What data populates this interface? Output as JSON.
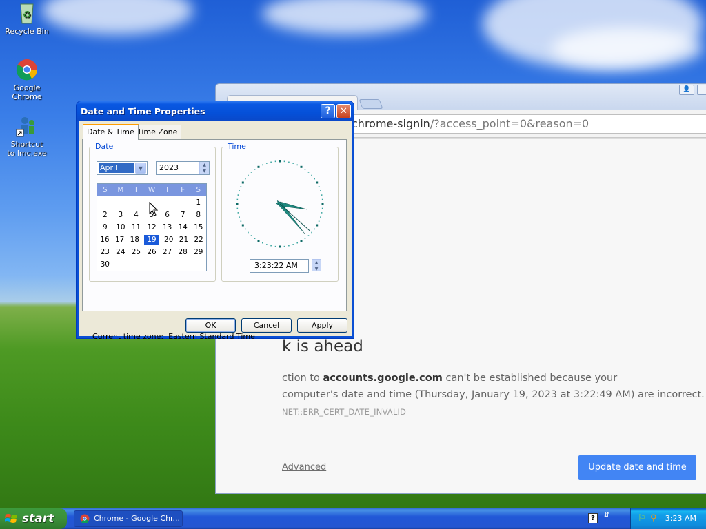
{
  "desktop": {
    "icons": [
      {
        "label": "Recycle Bin"
      },
      {
        "label": "Google Chrome"
      },
      {
        "label": "Shortcut to lmc.exe"
      }
    ]
  },
  "chrome": {
    "address_highlight": "chrome-signin",
    "address_rest": "/?access_point=0&reason=0",
    "error": {
      "heading": "k is ahead",
      "para_lead": "ction to ",
      "domain": "accounts.google.com",
      "para_tail": " can't be established because your",
      "para_line2": "computer's date and time (Thursday, January 19, 2023 at 3:22:49 AM) are incorrect.",
      "code": "NET::ERR_CERT_DATE_INVALID",
      "advanced": "Advanced",
      "update_button": "Update date and time"
    }
  },
  "dialog": {
    "title": "Date and Time Properties",
    "help": "?",
    "close": "✕",
    "tabs": [
      "Date & Time",
      "Time Zone"
    ],
    "date_group": "Date",
    "time_group": "Time",
    "month": "April",
    "year": "2023",
    "weekdays": [
      "S",
      "M",
      "T",
      "W",
      "T",
      "F",
      "S"
    ],
    "weeks": [
      [
        "",
        "",
        "",
        "",
        "",
        "",
        "1"
      ],
      [
        "2",
        "3",
        "4",
        "5",
        "6",
        "7",
        "8"
      ],
      [
        "9",
        "10",
        "11",
        "12",
        "13",
        "14",
        "15"
      ],
      [
        "16",
        "17",
        "18",
        "19",
        "20",
        "21",
        "22"
      ],
      [
        "23",
        "24",
        "25",
        "26",
        "27",
        "28",
        "29"
      ],
      [
        "30",
        "",
        "",
        "",
        "",
        "",
        ""
      ]
    ],
    "selected_day": "19",
    "time": "3:23:22 AM",
    "timezone_label": "Current time zone:",
    "timezone": "Eastern Standard Time",
    "buttons": {
      "ok": "OK",
      "cancel": "Cancel",
      "apply": "Apply"
    }
  },
  "taskbar": {
    "start": "start",
    "task_label": "Chrome - Google Chr...",
    "clock": "3:23 AM"
  },
  "colors": {
    "xp_blue": "#0a58e2",
    "chrome_button": "#4285f4",
    "clock_hands": "#1f8a80"
  }
}
